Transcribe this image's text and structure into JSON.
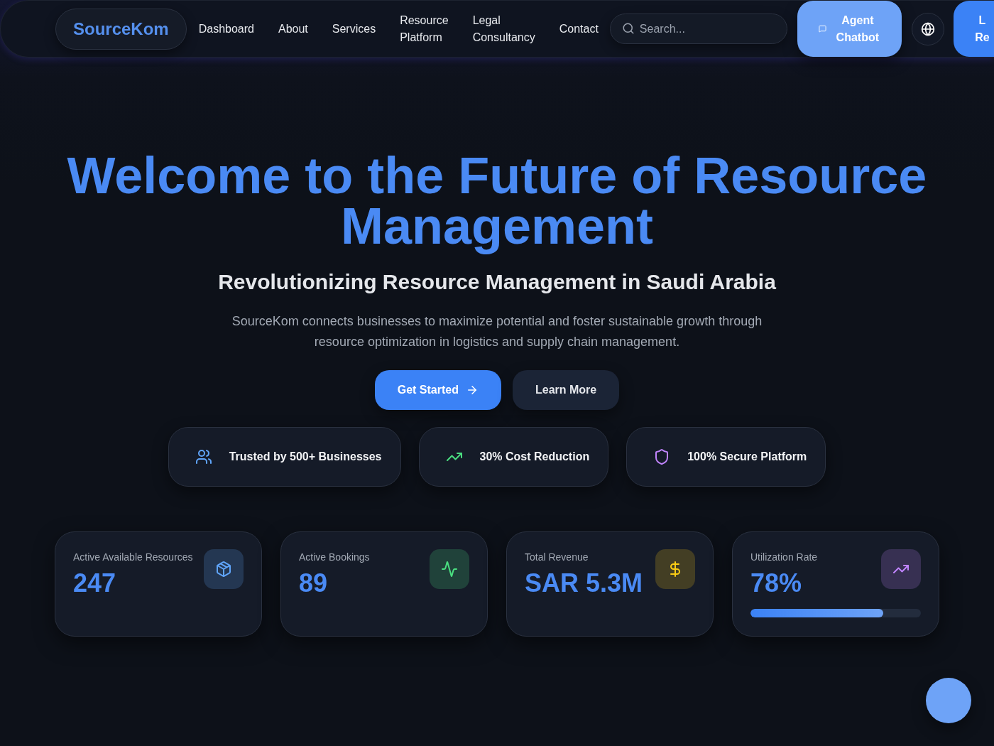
{
  "header": {
    "logo": "SourceKom",
    "nav": [
      "Dashboard",
      "About",
      "Services",
      "Resource Platform",
      "Legal Consultancy",
      "Contact"
    ],
    "search": {
      "placeholder": "Search..."
    },
    "chatbot_button": "Agent Chatbot",
    "account_button": [
      "L",
      "Re"
    ]
  },
  "hero": {
    "title": "Welcome to the Future of Resource Management",
    "subtitle": "Revolutionizing Resource Management in Saudi Arabia",
    "description": "SourceKom connects businesses to maximize potential and foster sustainable growth through resource optimization in logistics and supply chain management.",
    "buttons": [
      {
        "label": "Get Started",
        "kind": "primary"
      },
      {
        "label": "Learn More",
        "kind": "secondary"
      }
    ]
  },
  "highlights": [
    {
      "label": "Trusted by 500+ Businesses",
      "color": "#60a5fa"
    },
    {
      "label": "30% Cost Reduction",
      "color": "#4ade80"
    },
    {
      "label": "100% Secure Platform",
      "color": "#c084fc"
    }
  ],
  "stats": [
    {
      "label": "Active Available Resources",
      "value": "247",
      "color": "#60a5fa"
    },
    {
      "label": "Active Bookings",
      "value": "89",
      "color": "#4ade80"
    },
    {
      "label": "Total Revenue",
      "value": "SAR 5.3M",
      "color": "#facc15"
    },
    {
      "label": "Utilization Rate",
      "value": "78%",
      "color": "#c084fc",
      "level": 0.78
    }
  ]
}
